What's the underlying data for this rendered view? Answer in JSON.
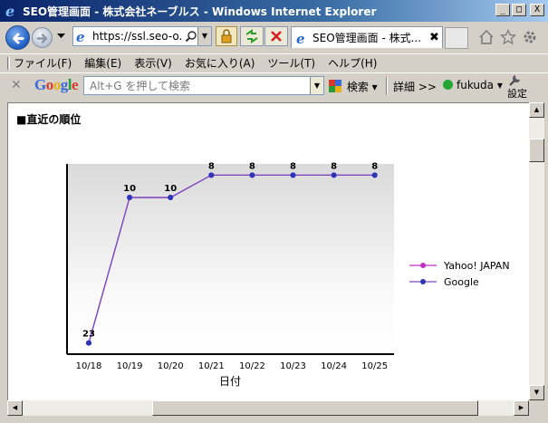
{
  "window": {
    "title": "SEO管理画面 - 株式会社ネーブルス - Windows Internet Explorer",
    "btn_min": "_",
    "btn_max": "□",
    "btn_close": "X"
  },
  "nav": {
    "address": "https://ssl.seo-o...",
    "tab_label": "SEO管理画面 - 株式...",
    "tab_close": "✖"
  },
  "menu": [
    "ファイル(F)",
    "編集(E)",
    "表示(V)",
    "お気に入り(A)",
    "ツール(T)",
    "ヘルプ(H)"
  ],
  "google_toolbar": {
    "logo": "Google",
    "search_placeholder": "Alt+G を押して検索",
    "search_label": "検索",
    "details_label": "詳細 >>",
    "user_label": "fukuda",
    "settings_label": "設定"
  },
  "page": {
    "section_title": "■直近の順位"
  },
  "colors": {
    "yahoo": "#c030c0",
    "google": "#2a35b8",
    "google_line": "#7a4ac0"
  },
  "chart_data": {
    "type": "line",
    "categories": [
      "10/18",
      "10/19",
      "10/20",
      "10/21",
      "10/22",
      "10/23",
      "10/24",
      "10/25"
    ],
    "series": [
      {
        "name": "Yahoo! JAPAN",
        "values": [
          23,
          10,
          10,
          8,
          8,
          8,
          8,
          8
        ]
      },
      {
        "name": "Google",
        "values": [
          23,
          10,
          10,
          8,
          8,
          8,
          8,
          8
        ]
      }
    ],
    "data_labels": [
      "23",
      "10",
      "10",
      "8",
      "8",
      "8",
      "8",
      "8"
    ],
    "xlabel": "日付",
    "ylabel": "",
    "y_reversed": true,
    "ylim": [
      7,
      24
    ],
    "legend": "right",
    "grid": false
  }
}
